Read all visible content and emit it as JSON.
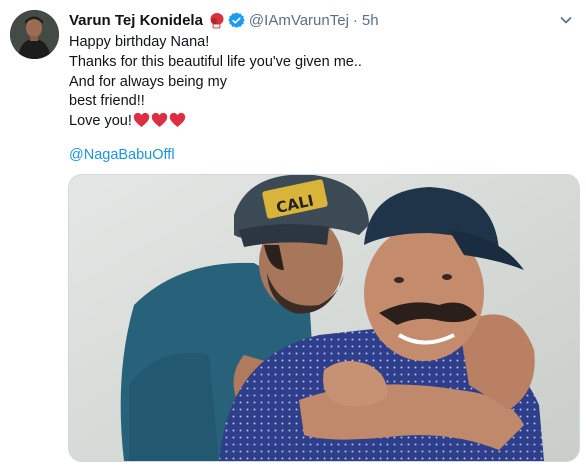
{
  "tweet": {
    "author_name": "Varun Tej Konidela",
    "handle": "@IAmVarunTej",
    "separator": "·",
    "time": "5h",
    "lines": [
      "Happy birthday Nana!",
      "Thanks for this beautiful life you've given me..",
      "And for always being my",
      "best friend!!",
      "Love you!"
    ],
    "mention": "@NagaBabuOffl",
    "cap_text": "CALI"
  },
  "colors": {
    "accent": "#1d9bf0",
    "heart": "#e0245e",
    "secondary_text": "#5b7083"
  },
  "icons": [
    "boxing-glove-icon",
    "verified-badge-icon",
    "chevron-down-icon",
    "red-heart-icon"
  ]
}
